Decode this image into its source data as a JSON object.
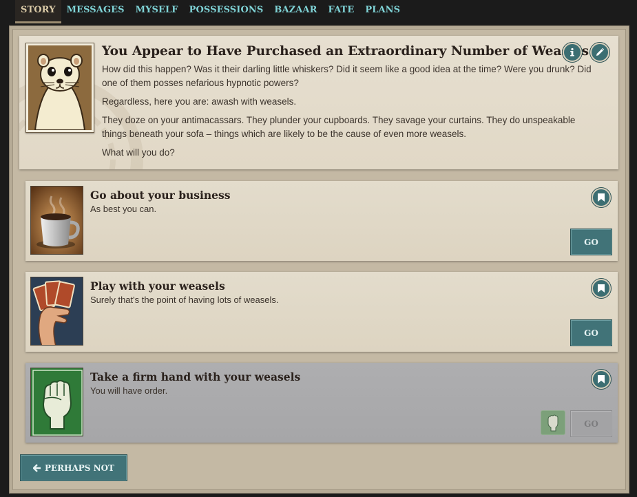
{
  "nav": {
    "tabs": [
      {
        "label": "STORY",
        "active": true
      },
      {
        "label": "MESSAGES",
        "active": false
      },
      {
        "label": "MYSELF",
        "active": false
      },
      {
        "label": "POSSESSIONS",
        "active": false
      },
      {
        "label": "BAZAAR",
        "active": false
      },
      {
        "label": "FATE",
        "active": false
      },
      {
        "label": "PLANS",
        "active": false
      }
    ]
  },
  "storylet": {
    "title": "You Appear to Have Purchased an Extraordinary Number of Weasels",
    "paragraphs": [
      "How did this happen? Was it their darling little whiskers? Did it seem like a good idea at the time? Were you drunk? Did one of them posses nefarious hypnotic powers?",
      "Regardless, here you are: awash with weasels.",
      "They doze on your antimacassars. They plunder your cupboards. They savage your curtains. They do unspeakable things beneath your sofa – things which are likely to be the cause of even more weasels.",
      "What will you do?"
    ],
    "info_icon": "info-icon",
    "edit_icon": "pencil-icon"
  },
  "branches": [
    {
      "title": "Go about your business",
      "description": "As best you can.",
      "go_label": "GO",
      "locked": false,
      "image": "coffee-mug"
    },
    {
      "title": "Play with your weasels",
      "description": "Surely that's the point of having lots of weasels.",
      "go_label": "GO",
      "locked": false,
      "image": "hand-of-cards"
    },
    {
      "title": "Take a firm hand with your weasels",
      "description": "You will have order.",
      "go_label": "GO",
      "locked": true,
      "image": "clenched-fist"
    }
  ],
  "perhaps_not": {
    "label": "PERHAPS NOT",
    "icon": "arrow-left-icon"
  },
  "colors": {
    "nav_link": "#7fd3d6",
    "button_teal": "#417378",
    "locked_bg": "#aaaaac"
  }
}
